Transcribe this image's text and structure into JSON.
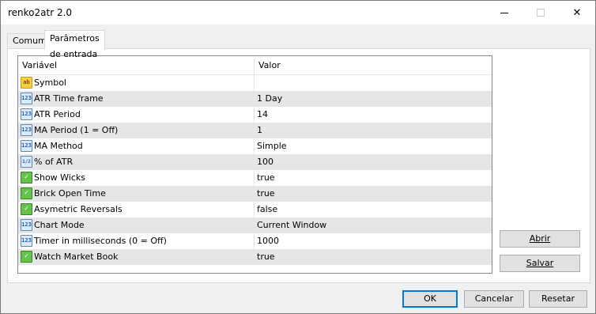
{
  "window": {
    "title": "renko2atr 2.0"
  },
  "tabs": [
    {
      "label": "Comum"
    },
    {
      "label": "Parâmetros de entrada"
    }
  ],
  "grid": {
    "headers": {
      "name": "Variável",
      "value": "Valor"
    },
    "rows": [
      {
        "icon": "string-type-icon",
        "badge": "ab",
        "name": "Symbol",
        "value": ""
      },
      {
        "icon": "integer-type-icon",
        "badge": "123",
        "name": "ATR Time frame",
        "value": "1 Day"
      },
      {
        "icon": "integer-type-icon",
        "badge": "123",
        "name": "ATR Period",
        "value": "14"
      },
      {
        "icon": "integer-type-icon",
        "badge": "123",
        "name": "MA Period (1 = Off)",
        "value": "1"
      },
      {
        "icon": "integer-type-icon",
        "badge": "123",
        "name": "MA Method",
        "value": "Simple"
      },
      {
        "icon": "double-type-icon",
        "badge": "1/2",
        "name": "% of ATR",
        "value": "100"
      },
      {
        "icon": "boolean-type-icon",
        "badge": "✓",
        "name": "Show Wicks",
        "value": "true"
      },
      {
        "icon": "boolean-type-icon",
        "badge": "✓",
        "name": "Brick Open Time",
        "value": "true"
      },
      {
        "icon": "boolean-type-icon",
        "badge": "✓",
        "name": "Asymetric Reversals",
        "value": "false"
      },
      {
        "icon": "integer-type-icon",
        "badge": "123",
        "name": "Chart Mode",
        "value": "Current Window"
      },
      {
        "icon": "integer-type-icon",
        "badge": "123",
        "name": "Timer in milliseconds (0 = Off)",
        "value": "1000"
      },
      {
        "icon": "boolean-type-icon",
        "badge": "✓",
        "name": "Watch Market Book",
        "value": "true"
      }
    ]
  },
  "side_buttons": {
    "load": "Abrir",
    "save": "Salvar"
  },
  "footer": {
    "ok": "OK",
    "cancel": "Cancelar",
    "reset": "Resetar"
  }
}
